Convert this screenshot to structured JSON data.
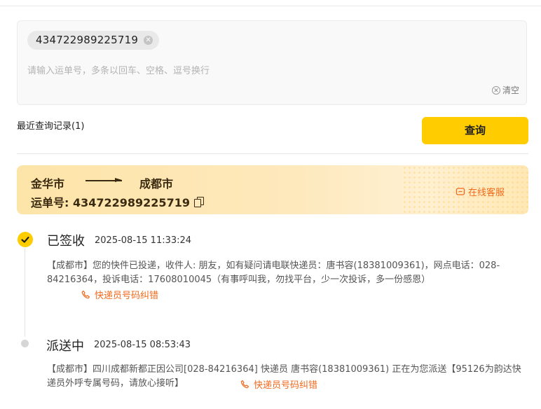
{
  "search": {
    "tag_number": "434722989225719",
    "placeholder": "请输入运单号，多条以回车、空格、逗号换行",
    "clear_label": "清空",
    "recent_label": "最近查询记录(1)",
    "search_button": "查询"
  },
  "route": {
    "from_city": "金华市",
    "to_city": "成都市",
    "waybill_label": "运单号: 434722989225719",
    "service_label": "在线客服"
  },
  "events": [
    {
      "status": "已签收",
      "time": "2025-08-15 11:33:24",
      "description": "【成都市】您的快件已投递，收件人: 朋友，如有疑问请电联快递员：唐书容(18381009361)，网点电话：028-84216364，投诉电话：17608010045（有事呼叫我，勿找平台，少一次投诉，多一份感恩）",
      "correction_label": "快递员号码纠错"
    },
    {
      "status": "派送中",
      "time": "2025-08-15 08:53:43",
      "description": "【成都市】四川成都新都正因公司[028-84216364] 快递员 唐书容(18381009361) 正在为您派送【95126为韵达快递员外呼专属号码，请放心接听】",
      "correction_label": "快递员号码纠错"
    }
  ],
  "colors": {
    "accent": "#ffcc00",
    "link_orange": "#f06a1d",
    "card_bg": "#fee9bd"
  },
  "icons": {
    "tag_close": "close-circle-icon",
    "clear": "clear-circle-icon",
    "copy": "copy-icon",
    "service": "chat-icon",
    "check": "check-icon",
    "phone": "phone-icon"
  }
}
